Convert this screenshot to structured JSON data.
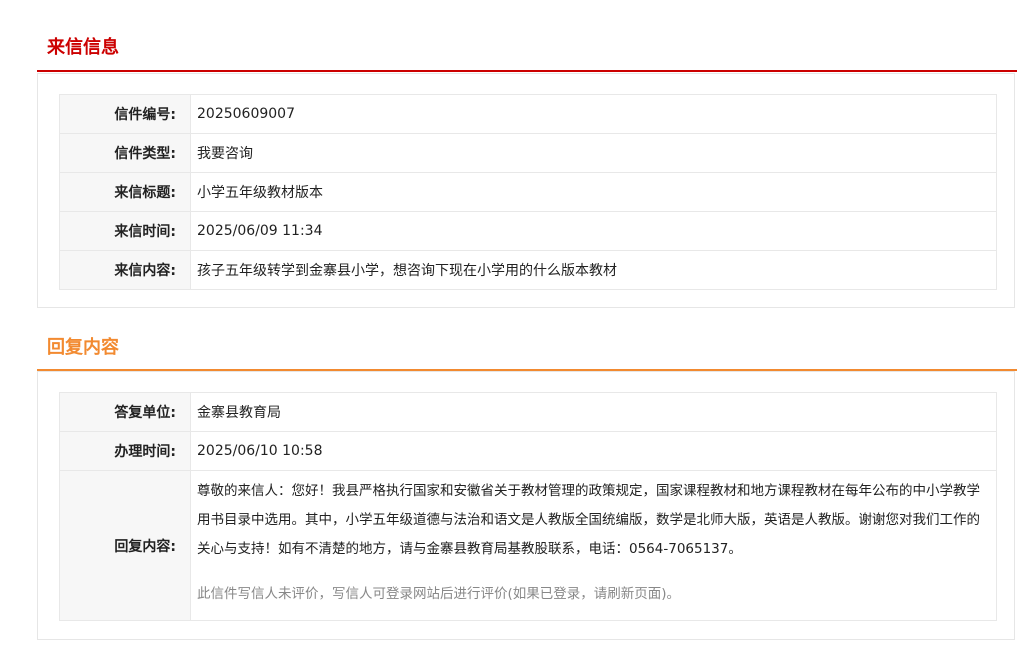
{
  "letter_section": {
    "title": "来信信息",
    "color": "#cc0000",
    "rows": [
      {
        "label": "信件编号:",
        "value": "20250609007"
      },
      {
        "label": "信件类型:",
        "value": "我要咨询"
      },
      {
        "label": "来信标题:",
        "value": "小学五年级教材版本"
      },
      {
        "label": "来信时间:",
        "value": "2025/06/09 11:34"
      },
      {
        "label": "来信内容:",
        "value": "孩子五年级转学到金寨县小学，想咨询下现在小学用的什么版本教材"
      }
    ]
  },
  "reply_section": {
    "title": "回复内容",
    "color": "#f28a30",
    "rows": [
      {
        "label": "答复单位:",
        "value": "金寨县教育局"
      },
      {
        "label": "办理时间:",
        "value": "2025/06/10 10:58"
      }
    ],
    "content_label": "回复内容:",
    "content_text": "尊敬的来信人：您好！我县严格执行国家和安徽省关于教材管理的政策规定，国家课程教材和地方课程教材在每年公布的中小学教学用书目录中选用。其中，小学五年级道德与法治和语文是人教版全国统编版，数学是北师大版，英语是人教版。谢谢您对我们工作的关心与支持！如有不清楚的地方，请与金寨县教育局基教股联系，电话：0564-7065137。",
    "evaluation_note": "此信件写信人未评价，写信人可登录网站后进行评价(如果已登录，请刷新页面)。"
  }
}
